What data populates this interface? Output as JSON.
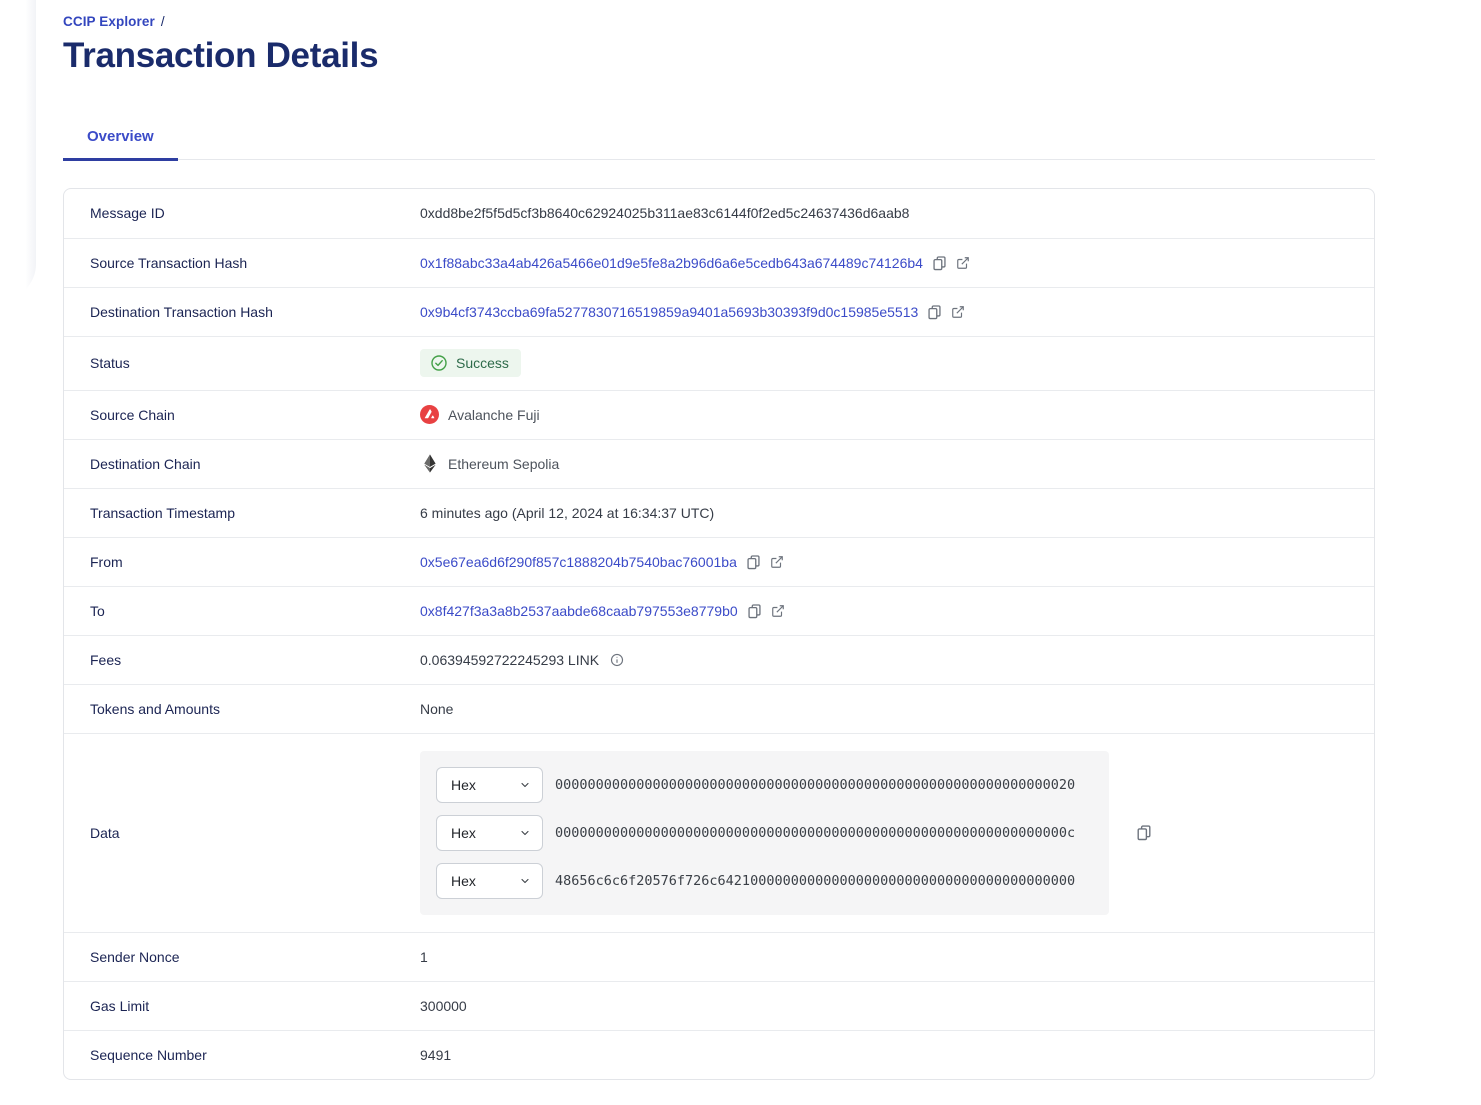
{
  "breadcrumb": {
    "label": "CCIP Explorer",
    "separator": "/"
  },
  "title": "Transaction Details",
  "tabs": {
    "overview": "Overview"
  },
  "rows": {
    "message_id": {
      "label": "Message ID",
      "value": "0xdd8be2f5f5d5cf3b8640c62924025b311ae83c6144f0f2ed5c24637436d6aab8"
    },
    "source_tx": {
      "label": "Source Transaction Hash",
      "value": "0x1f88abc33a4ab426a5466e01d9e5fe8a2b96d6a6e5cedb643a674489c74126b4"
    },
    "dest_tx": {
      "label": "Destination Transaction Hash",
      "value": "0x9b4cf3743ccba69fa5277830716519859a9401a5693b30393f9d0c15985e5513"
    },
    "status": {
      "label": "Status",
      "value": "Success"
    },
    "source_chain": {
      "label": "Source Chain",
      "value": "Avalanche Fuji"
    },
    "dest_chain": {
      "label": "Destination Chain",
      "value": "Ethereum Sepolia"
    },
    "timestamp": {
      "label": "Transaction Timestamp",
      "value": "6 minutes ago (April 12, 2024 at 16:34:37 UTC)"
    },
    "from": {
      "label": "From",
      "value": "0x5e67ea6d6f290f857c1888204b7540bac76001ba"
    },
    "to": {
      "label": "To",
      "value": "0x8f427f3a3a8b2537aabde68caab797553e8779b0"
    },
    "fees": {
      "label": "Fees",
      "value": "0.06394592722245293 LINK"
    },
    "tokens": {
      "label": "Tokens and Amounts",
      "value": "None"
    },
    "data": {
      "label": "Data",
      "format_label": "Hex",
      "lines": [
        "0000000000000000000000000000000000000000000000000000000000000020",
        "000000000000000000000000000000000000000000000000000000000000000c",
        "48656c6c6f20576f726c64210000000000000000000000000000000000000000"
      ]
    },
    "sender_nonce": {
      "label": "Sender Nonce",
      "value": "1"
    },
    "gas_limit": {
      "label": "Gas Limit",
      "value": "300000"
    },
    "sequence_number": {
      "label": "Sequence Number",
      "value": "9491"
    }
  },
  "icons": {
    "copy": "copy-icon",
    "external": "external-link-icon",
    "check": "check-circle-icon",
    "info": "info-icon",
    "chevron": "chevron-down-icon",
    "avalanche": "avalanche-icon",
    "ethereum": "ethereum-icon"
  },
  "colors": {
    "brand_blue": "#3346BE",
    "link_blue": "#3B4BC8",
    "title_navy": "#1A2B6B",
    "label_navy": "#1B2453",
    "tab_underline": "#2E3EA1",
    "success_text": "#2E6B4A",
    "success_bg": "#EDF6EE",
    "success_icon": "#43A047",
    "avalanche_red": "#E84142"
  }
}
